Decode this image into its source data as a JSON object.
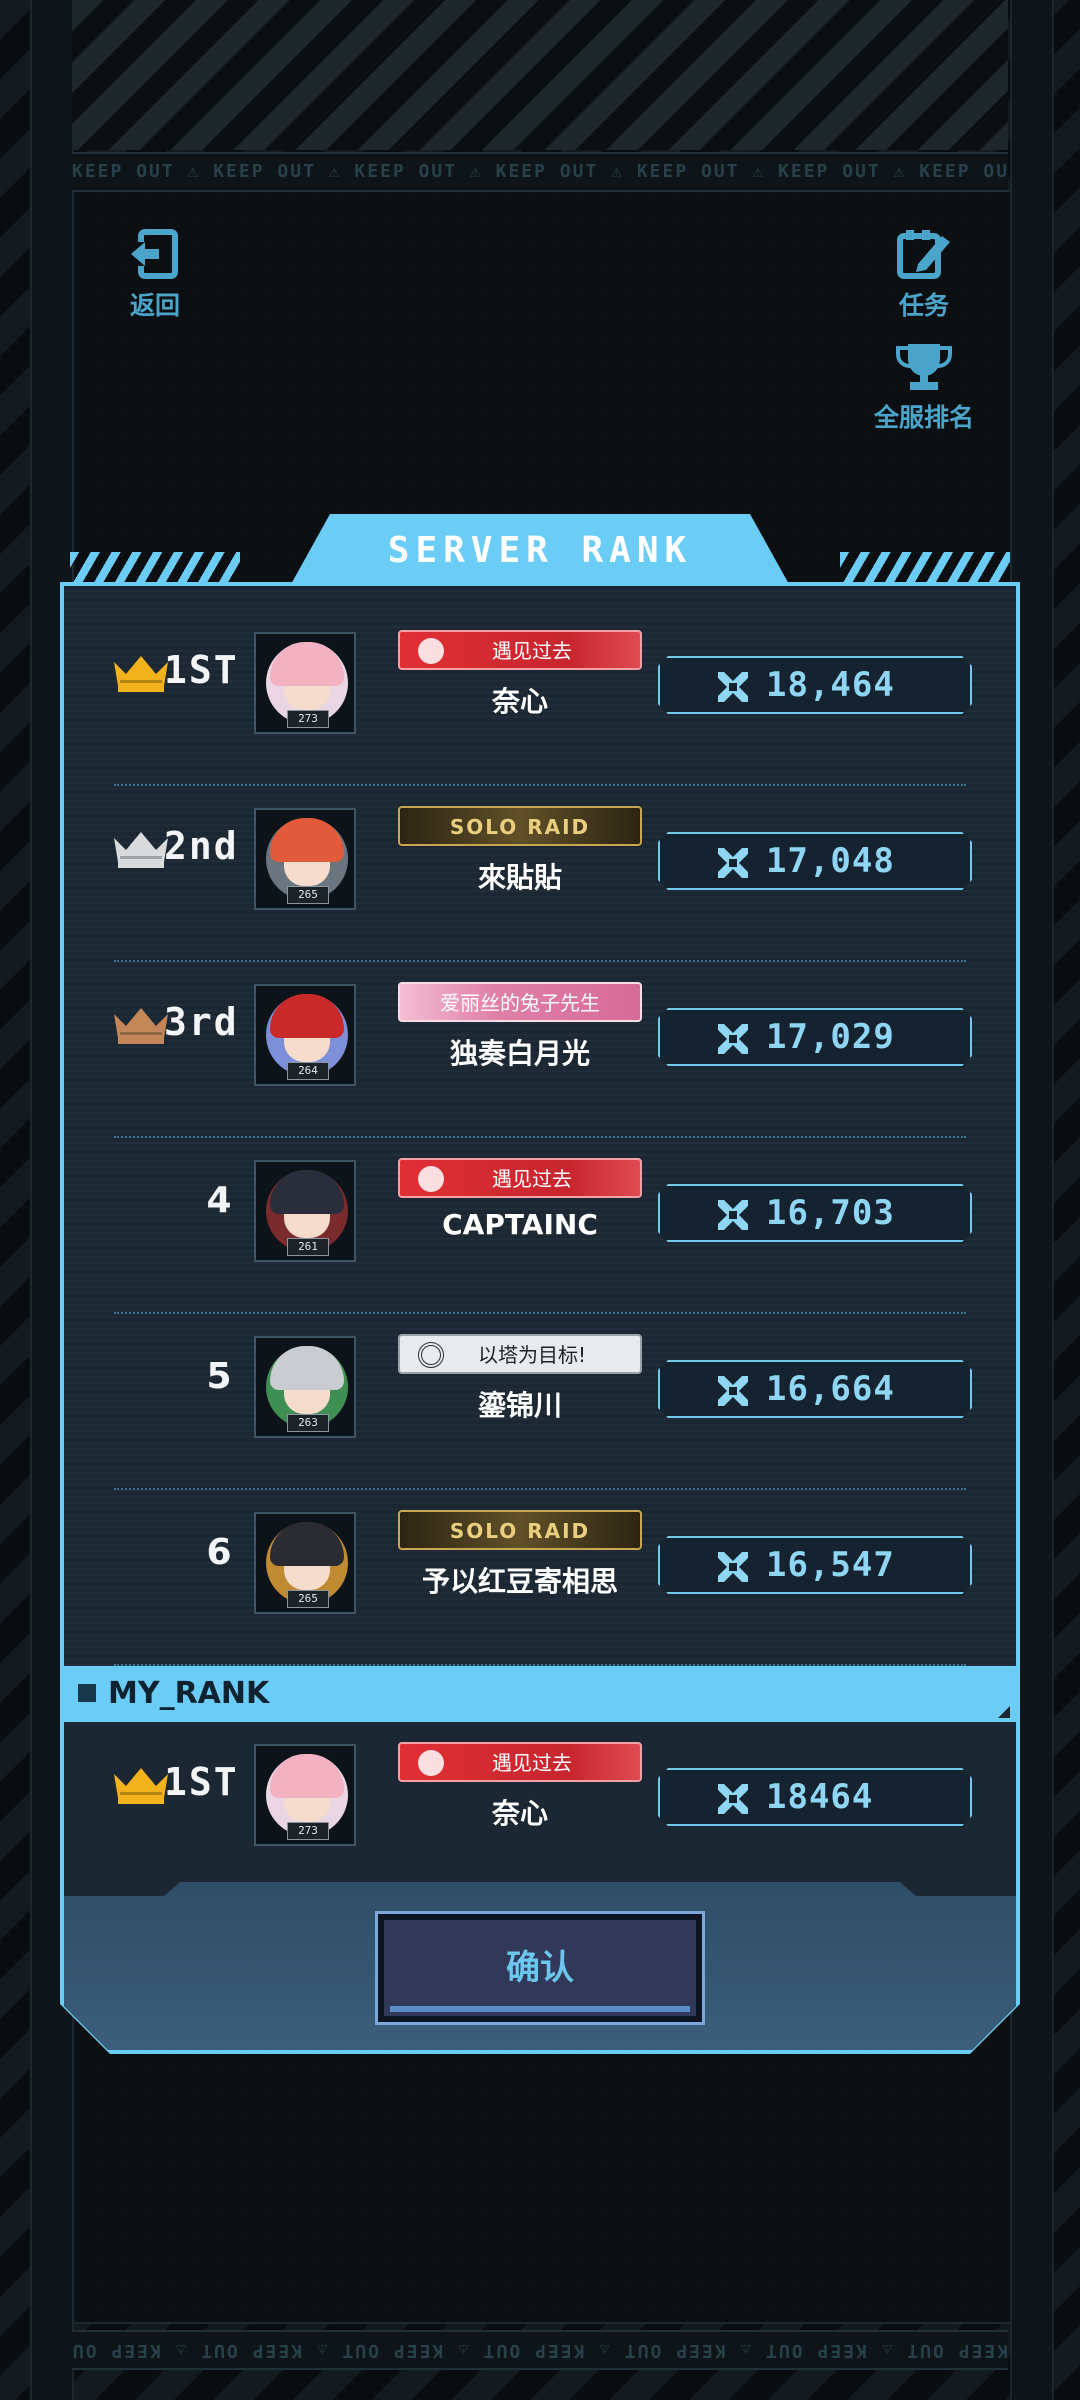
{
  "tape_text": "KEEP OUT ⚠ KEEP OUT ⚠ KEEP OUT ⚠ KEEP OUT ⚠ KEEP OUT ⚠ KEEP OUT ⚠ KEEP OUT ⚠",
  "top": {
    "back_label": "返回",
    "task_label": "任务",
    "server_rank_label": "全服排名"
  },
  "panel": {
    "title": "SERVER RANK"
  },
  "ranks": [
    {
      "rank": "1ST",
      "crown": "gold",
      "level": "273",
      "badge_style": "red",
      "badge_text": "遇见过去",
      "name": "奈心",
      "score": "18,464",
      "avatar_hair": "#f3b2c2",
      "avatar_bg": "#e9d6e2"
    },
    {
      "rank": "2nd",
      "crown": "silver",
      "level": "265",
      "badge_style": "gold",
      "badge_text": "SOLO RAID",
      "name": "來貼貼",
      "score": "17,048",
      "avatar_hair": "#e25a3c",
      "avatar_bg": "#6a7580"
    },
    {
      "rank": "3rd",
      "crown": "bronze",
      "level": "264",
      "badge_style": "pink",
      "badge_text": "爱丽丝的兔子先生",
      "name": "独奏白月光",
      "score": "17,029",
      "avatar_hair": "#c82a2a",
      "avatar_bg": "#7d8fd8"
    },
    {
      "rank": "4",
      "crown": "",
      "level": "261",
      "badge_style": "red",
      "badge_text": "遇见过去",
      "name": "CAPTAINC",
      "score": "16,703",
      "avatar_hair": "#2a2e3a",
      "avatar_bg": "#7a2b2e"
    },
    {
      "rank": "5",
      "crown": "",
      "level": "263",
      "badge_style": "grey",
      "badge_text": "以塔为目标!",
      "name": "鎏锦川",
      "score": "16,664",
      "avatar_hair": "#c9ccd0",
      "avatar_bg": "#3f8f55"
    },
    {
      "rank": "6",
      "crown": "",
      "level": "265",
      "badge_style": "gold",
      "badge_text": "SOLO RAID",
      "name": "予以红豆寄相思",
      "score": "16,547",
      "avatar_hair": "#2b2c33",
      "avatar_bg": "#c08a32"
    }
  ],
  "my_rank": {
    "label": "MY_RANK",
    "rank": "1ST",
    "crown": "gold",
    "level": "273",
    "badge_style": "red",
    "badge_text": "遇见过去",
    "name": "奈心",
    "score": "18464",
    "avatar_hair": "#f3b2c2",
    "avatar_bg": "#e9d6e2"
  },
  "confirm_label": "确认",
  "colors": {
    "accent": "#6bcdf6",
    "score_text": "#8fd6f5",
    "gold": "#f2b21c",
    "silver": "#d8dadc",
    "bronze": "#c3875a"
  },
  "icons": [
    "exit-icon",
    "task-pencil-icon",
    "trophy-icon",
    "crown-icon",
    "crossed-swords-icon"
  ]
}
